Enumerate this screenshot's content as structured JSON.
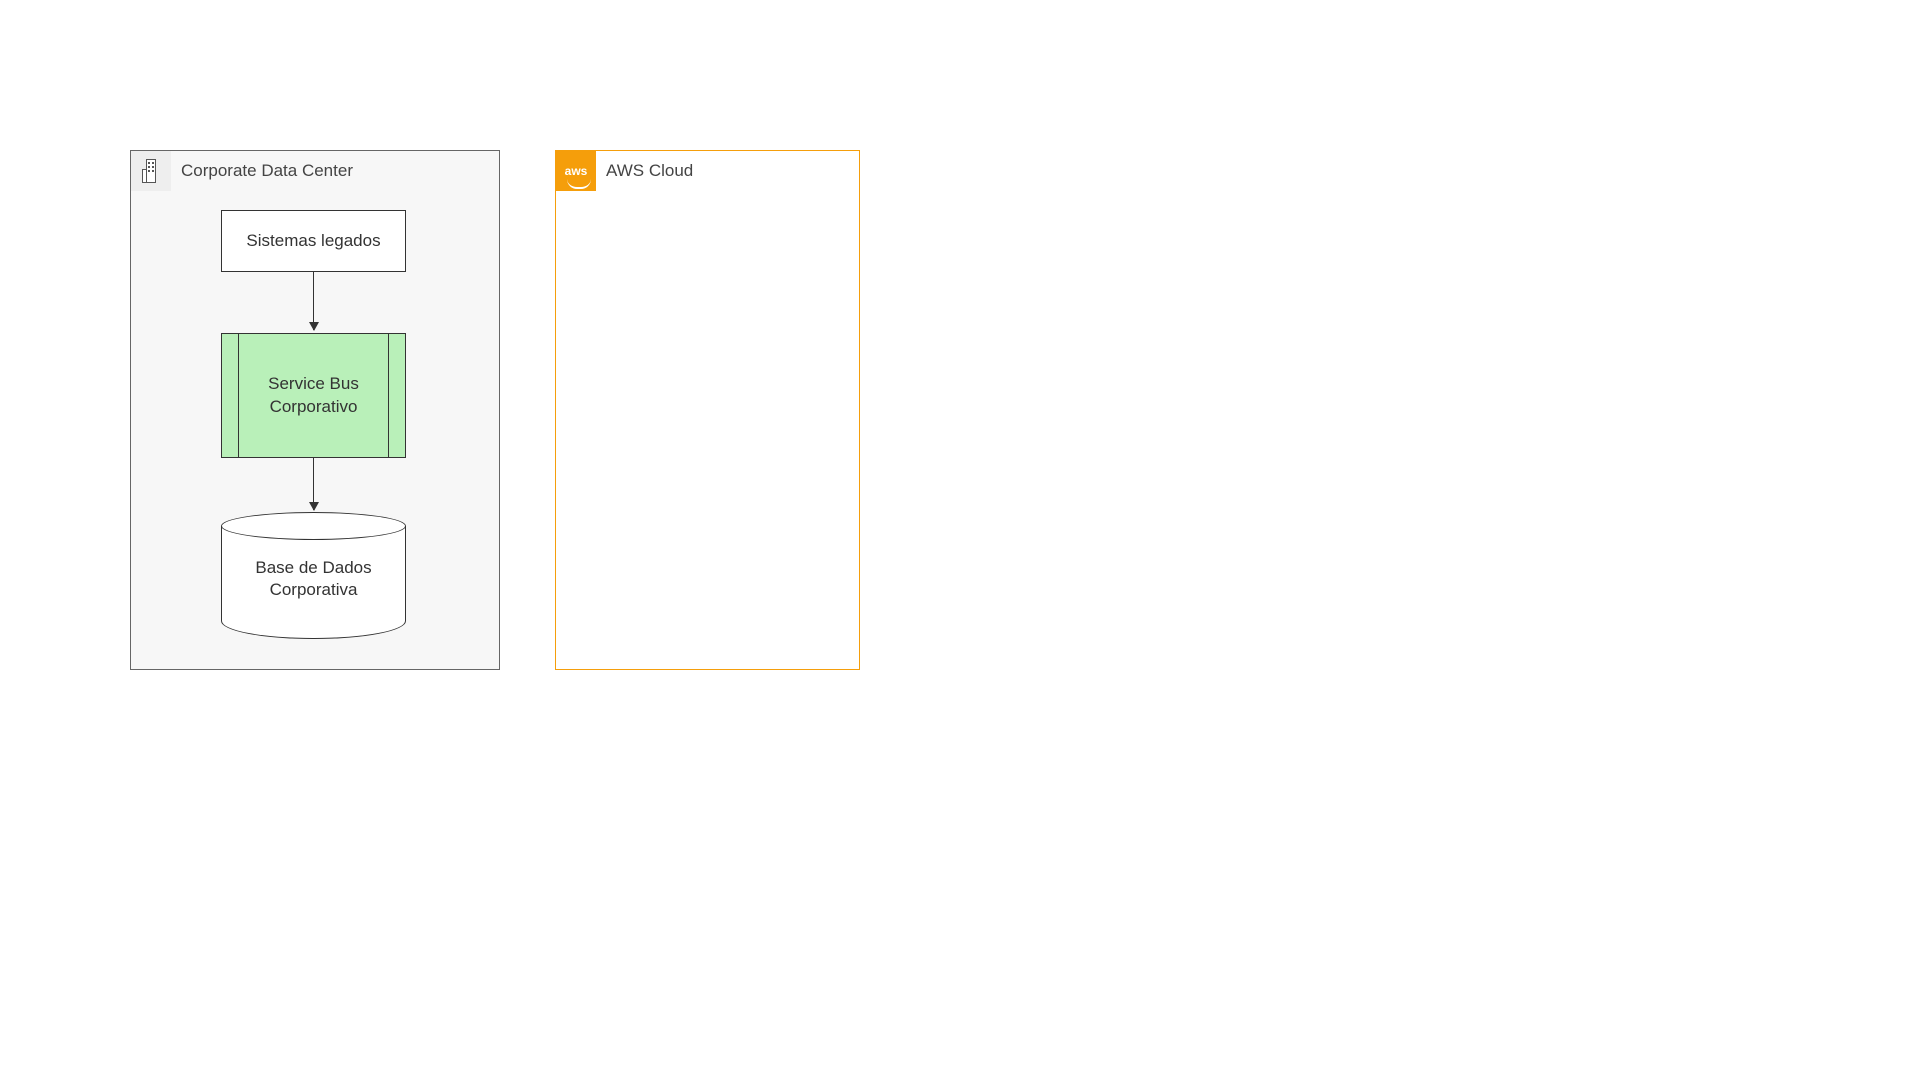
{
  "groups": {
    "corporate": {
      "label": "Corporate Data Center"
    },
    "aws": {
      "label": "AWS Cloud"
    }
  },
  "nodes": {
    "legacy": {
      "label": "Sistemas legados"
    },
    "bus": {
      "label": "Service Bus Corporativo"
    },
    "db": {
      "label": "Base de Dados Corporativa"
    }
  }
}
